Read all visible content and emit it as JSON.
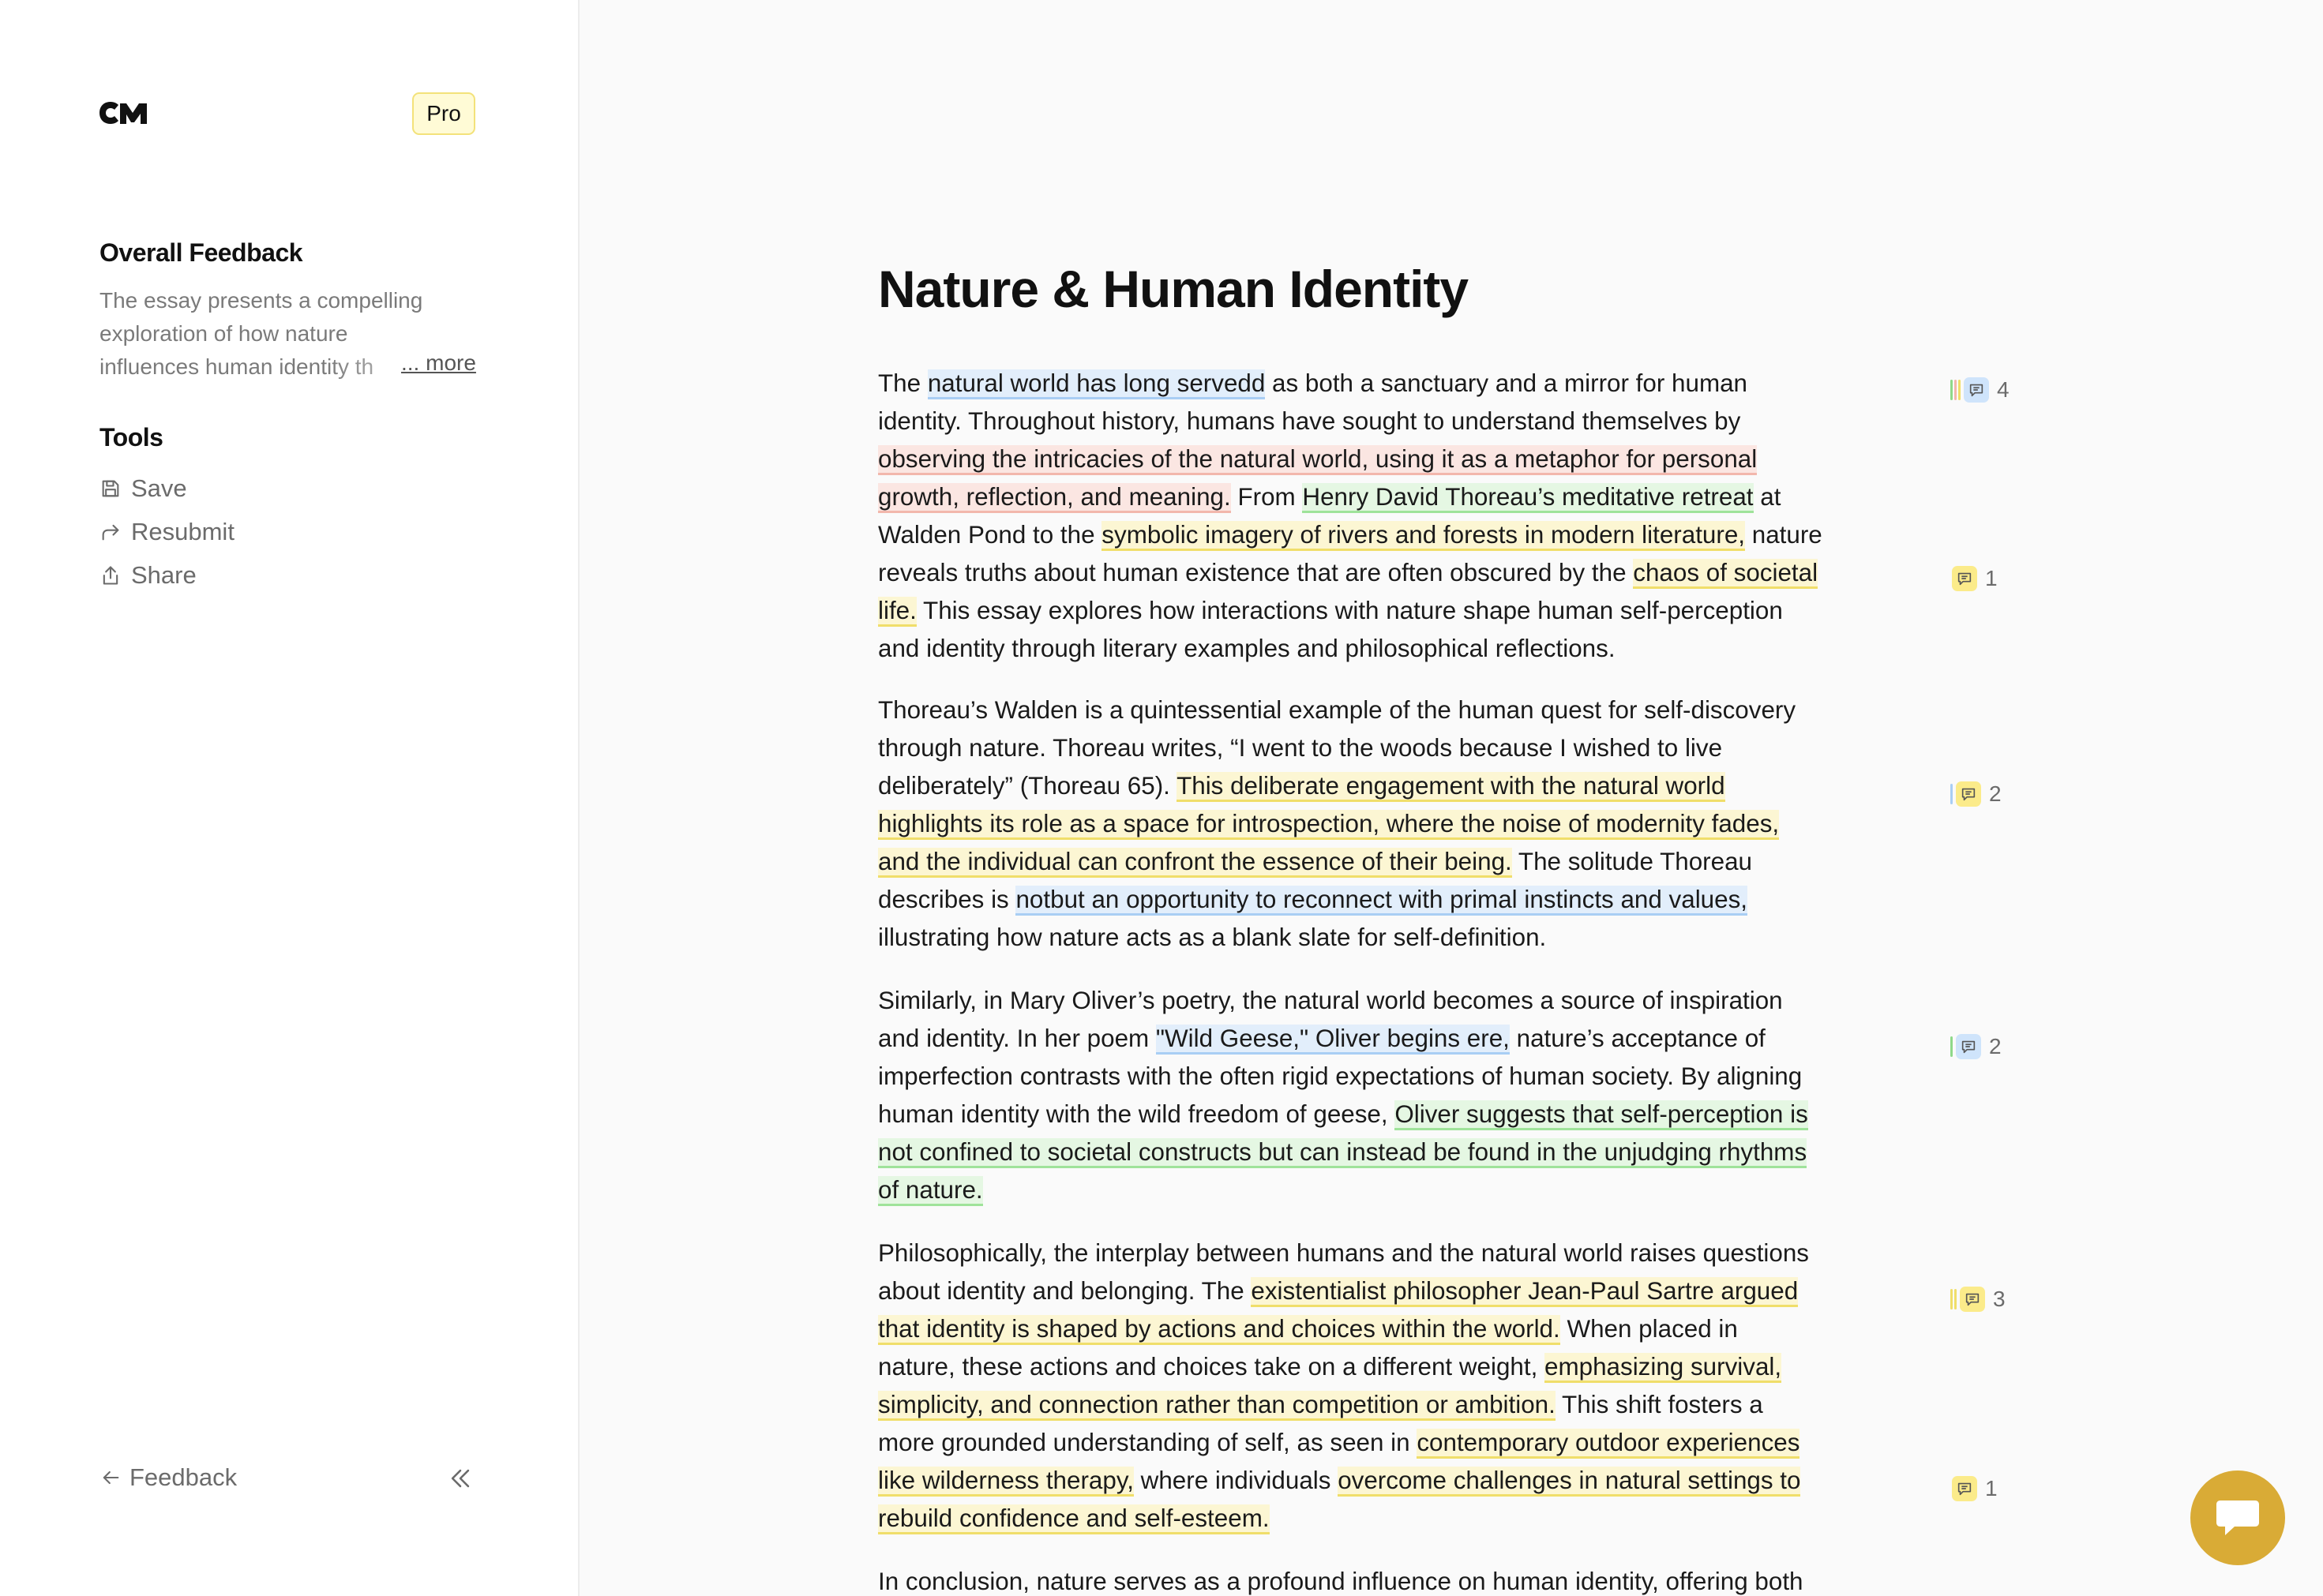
{
  "sidebar": {
    "logo": "cm-logo",
    "plan_badge": "Pro",
    "overall_feedback": {
      "title": "Overall Feedback",
      "line1": "The essay presents a compelling",
      "line2": "exploration of how nature",
      "line3": "influences human identity th",
      "more_label": "... more"
    },
    "tools": {
      "title": "Tools",
      "save": "Save",
      "resubmit": "Resubmit",
      "share": "Share"
    },
    "feedback_label": "Feedback",
    "icons": {
      "save": "save-icon",
      "resubmit": "redo-arrow-icon",
      "share": "share-icon",
      "back": "arrow-left-icon",
      "collapse": "double-chevron-left-icon"
    }
  },
  "document": {
    "title": "Nature & Human Identity",
    "p1": {
      "l1a": "The ",
      "l1b": "natural world has long servedd",
      "l1c": " as both a sanctuary and a mirror for human",
      "l2": "identity. Throughout history, humans have sought to understand themselves by",
      "l3": "observing the intricacies of the natural world, using it as a metaphor for personal",
      "l4a": "growth, reflection, and meaning.",
      "l4b": " From ",
      "l4c": "Henry David Thoreau’s meditative retreat",
      "l4d": " at",
      "l5a": "Walden Pond to the ",
      "l5b": "symbolic imagery of rivers and forests in modern literature,",
      "l5c": " nature",
      "l6a": "reveals truths about human existence that are often obscured by the ",
      "l6b": "chaos of societal",
      "l7a": "life.",
      "l7b": " This essay explores how interactions with nature shape human self-perception",
      "l8": "and identity through literary examples and philosophical reflections."
    },
    "p2": {
      "l1": "Thoreau’s Walden is a quintessential example of the human quest for self-discovery",
      "l2": "through nature. Thoreau writes, “I went to the woods because I wished to live",
      "l3a": "deliberately” (Thoreau 65). ",
      "l3b": "This deliberate engagement with the natural world",
      "l4": "highlights its role as a space for introspection, where the noise of modernity fades,",
      "l5a": "and the individual can confront the essence of their being.",
      "l5b": " The solitude Thoreau",
      "l6a": "describes is ",
      "l6b": "notbut an opportunity to reconnect with primal instincts and values,",
      "l7": "illustrating how nature acts as a blank slate for self-definition."
    },
    "p3": {
      "l1": "Similarly, in Mary Oliver’s poetry, the natural world becomes a source of inspiration",
      "l2a": "and identity. In her poem ",
      "l2b": "\"Wild Geese,\" Oliver begins ere,",
      "l2c": " nature’s acceptance of",
      "l3": "imperfection contrasts with the often rigid expectations of human society. By aligning",
      "l4a": "human identity with the wild freedom of geese, ",
      "l4b": "Oliver suggests that self-perception is",
      "l5": "not confined to societal constructs but can instead be found in the unjudging rhythms",
      "l6": "of nature."
    },
    "p4": {
      "l1": "Philosophically, the interplay between humans and the natural world raises questions",
      "l2a": "about identity and belonging. The ",
      "l2b": "existentialist philosopher Jean-Paul Sartre argued",
      "l3a": "that identity is shaped by actions and choices within the world.",
      "l3b": " When placed in",
      "l4a": "nature, these actions and choices take on a different weight, ",
      "l4b": "emphasizing survival,",
      "l5a": "simplicity, and connection rather than competition or ambition.",
      "l5b": " This shift fosters a",
      "l6a": "more grounded understanding of self, as seen in ",
      "l6b": "contemporary outdoor experiences",
      "l7a": "like wilderness therapy,",
      "l7b": " where individuals ",
      "l7c": "overcome challenges in natural settings to",
      "l8": "rebuild confidence and self-esteem."
    },
    "p5": {
      "l1": "In conclusion, nature serves as a profound influence on human identity, offering both"
    }
  },
  "markers": [
    {
      "count": "4",
      "bars": [
        "#8fd98a",
        "#f2b7ac",
        "#f0de6a"
      ],
      "chip": "blue"
    },
    {
      "count": "1",
      "bars": [],
      "chip": "yellow"
    },
    {
      "count": "2",
      "bars": [
        "#a9cef4"
      ],
      "chip": "yellow"
    },
    {
      "count": "2",
      "bars": [
        "#8fd98a"
      ],
      "chip": "blue"
    },
    {
      "count": "3",
      "bars": [
        "#f0de6a",
        "#f0de6a"
      ],
      "chip": "yellow"
    },
    {
      "count": "1",
      "bars": [],
      "chip": "yellow"
    }
  ],
  "colors": {
    "highlight_blue": "#e2eefb",
    "highlight_red": "#fbe6e2",
    "highlight_green": "#e5f7e3",
    "highlight_yellow": "#fcf6d3",
    "chat_bubble": "#d9ab36",
    "badge_bg": "#fffbd6"
  },
  "chat": {
    "icon": "chat-bubble-icon"
  }
}
